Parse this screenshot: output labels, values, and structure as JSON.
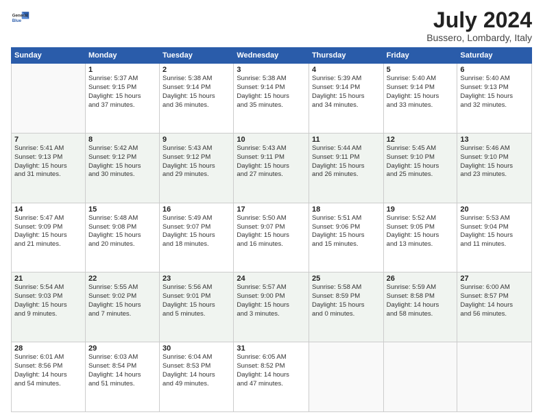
{
  "logo": {
    "line1": "General",
    "line2": "Blue"
  },
  "title": "July 2024",
  "location": "Bussero, Lombardy, Italy",
  "weekdays": [
    "Sunday",
    "Monday",
    "Tuesday",
    "Wednesday",
    "Thursday",
    "Friday",
    "Saturday"
  ],
  "weeks": [
    [
      {
        "day": "",
        "info": ""
      },
      {
        "day": "1",
        "info": "Sunrise: 5:37 AM\nSunset: 9:15 PM\nDaylight: 15 hours\nand 37 minutes."
      },
      {
        "day": "2",
        "info": "Sunrise: 5:38 AM\nSunset: 9:14 PM\nDaylight: 15 hours\nand 36 minutes."
      },
      {
        "day": "3",
        "info": "Sunrise: 5:38 AM\nSunset: 9:14 PM\nDaylight: 15 hours\nand 35 minutes."
      },
      {
        "day": "4",
        "info": "Sunrise: 5:39 AM\nSunset: 9:14 PM\nDaylight: 15 hours\nand 34 minutes."
      },
      {
        "day": "5",
        "info": "Sunrise: 5:40 AM\nSunset: 9:14 PM\nDaylight: 15 hours\nand 33 minutes."
      },
      {
        "day": "6",
        "info": "Sunrise: 5:40 AM\nSunset: 9:13 PM\nDaylight: 15 hours\nand 32 minutes."
      }
    ],
    [
      {
        "day": "7",
        "info": "Sunrise: 5:41 AM\nSunset: 9:13 PM\nDaylight: 15 hours\nand 31 minutes."
      },
      {
        "day": "8",
        "info": "Sunrise: 5:42 AM\nSunset: 9:12 PM\nDaylight: 15 hours\nand 30 minutes."
      },
      {
        "day": "9",
        "info": "Sunrise: 5:43 AM\nSunset: 9:12 PM\nDaylight: 15 hours\nand 29 minutes."
      },
      {
        "day": "10",
        "info": "Sunrise: 5:43 AM\nSunset: 9:11 PM\nDaylight: 15 hours\nand 27 minutes."
      },
      {
        "day": "11",
        "info": "Sunrise: 5:44 AM\nSunset: 9:11 PM\nDaylight: 15 hours\nand 26 minutes."
      },
      {
        "day": "12",
        "info": "Sunrise: 5:45 AM\nSunset: 9:10 PM\nDaylight: 15 hours\nand 25 minutes."
      },
      {
        "day": "13",
        "info": "Sunrise: 5:46 AM\nSunset: 9:10 PM\nDaylight: 15 hours\nand 23 minutes."
      }
    ],
    [
      {
        "day": "14",
        "info": "Sunrise: 5:47 AM\nSunset: 9:09 PM\nDaylight: 15 hours\nand 21 minutes."
      },
      {
        "day": "15",
        "info": "Sunrise: 5:48 AM\nSunset: 9:08 PM\nDaylight: 15 hours\nand 20 minutes."
      },
      {
        "day": "16",
        "info": "Sunrise: 5:49 AM\nSunset: 9:07 PM\nDaylight: 15 hours\nand 18 minutes."
      },
      {
        "day": "17",
        "info": "Sunrise: 5:50 AM\nSunset: 9:07 PM\nDaylight: 15 hours\nand 16 minutes."
      },
      {
        "day": "18",
        "info": "Sunrise: 5:51 AM\nSunset: 9:06 PM\nDaylight: 15 hours\nand 15 minutes."
      },
      {
        "day": "19",
        "info": "Sunrise: 5:52 AM\nSunset: 9:05 PM\nDaylight: 15 hours\nand 13 minutes."
      },
      {
        "day": "20",
        "info": "Sunrise: 5:53 AM\nSunset: 9:04 PM\nDaylight: 15 hours\nand 11 minutes."
      }
    ],
    [
      {
        "day": "21",
        "info": "Sunrise: 5:54 AM\nSunset: 9:03 PM\nDaylight: 15 hours\nand 9 minutes."
      },
      {
        "day": "22",
        "info": "Sunrise: 5:55 AM\nSunset: 9:02 PM\nDaylight: 15 hours\nand 7 minutes."
      },
      {
        "day": "23",
        "info": "Sunrise: 5:56 AM\nSunset: 9:01 PM\nDaylight: 15 hours\nand 5 minutes."
      },
      {
        "day": "24",
        "info": "Sunrise: 5:57 AM\nSunset: 9:00 PM\nDaylight: 15 hours\nand 3 minutes."
      },
      {
        "day": "25",
        "info": "Sunrise: 5:58 AM\nSunset: 8:59 PM\nDaylight: 15 hours\nand 0 minutes."
      },
      {
        "day": "26",
        "info": "Sunrise: 5:59 AM\nSunset: 8:58 PM\nDaylight: 14 hours\nand 58 minutes."
      },
      {
        "day": "27",
        "info": "Sunrise: 6:00 AM\nSunset: 8:57 PM\nDaylight: 14 hours\nand 56 minutes."
      }
    ],
    [
      {
        "day": "28",
        "info": "Sunrise: 6:01 AM\nSunset: 8:56 PM\nDaylight: 14 hours\nand 54 minutes."
      },
      {
        "day": "29",
        "info": "Sunrise: 6:03 AM\nSunset: 8:54 PM\nDaylight: 14 hours\nand 51 minutes."
      },
      {
        "day": "30",
        "info": "Sunrise: 6:04 AM\nSunset: 8:53 PM\nDaylight: 14 hours\nand 49 minutes."
      },
      {
        "day": "31",
        "info": "Sunrise: 6:05 AM\nSunset: 8:52 PM\nDaylight: 14 hours\nand 47 minutes."
      },
      {
        "day": "",
        "info": ""
      },
      {
        "day": "",
        "info": ""
      },
      {
        "day": "",
        "info": ""
      }
    ]
  ]
}
